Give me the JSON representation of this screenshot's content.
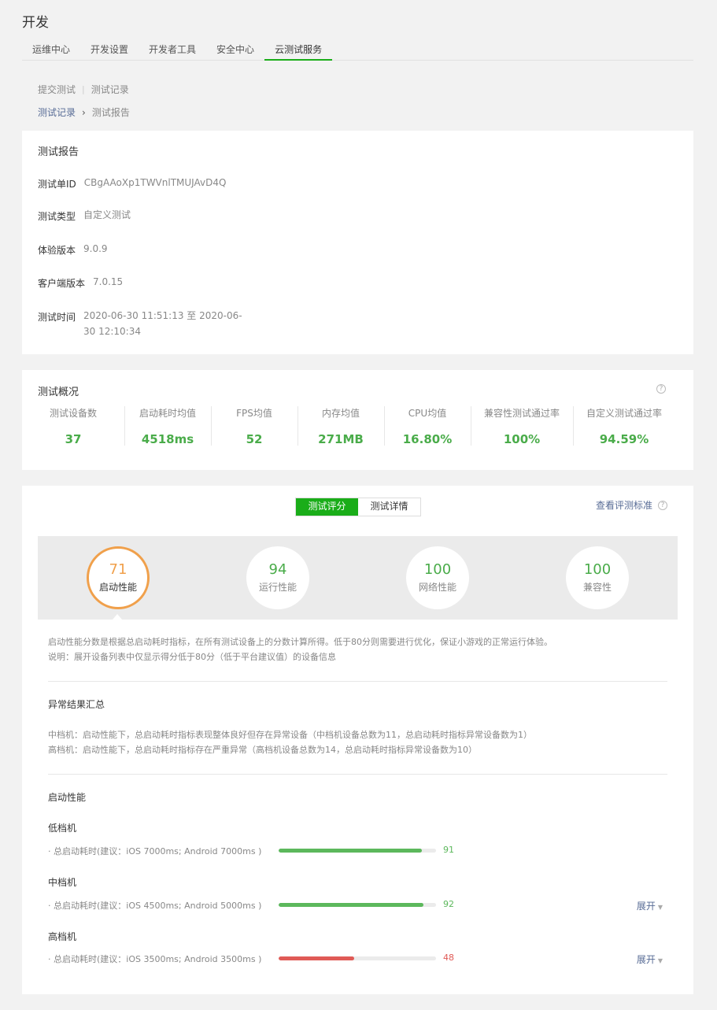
{
  "page_title": "开发",
  "top_tabs": [
    {
      "label": "运维中心"
    },
    {
      "label": "开发设置"
    },
    {
      "label": "开发者工具"
    },
    {
      "label": "安全中心"
    },
    {
      "label": "云测试服务",
      "active": true
    }
  ],
  "sub_nav": {
    "submit": "提交测试",
    "records": "测试记录"
  },
  "breadcrumb": {
    "parent": "测试记录",
    "current": "测试报告"
  },
  "report": {
    "title": "测试报告",
    "fields": [
      {
        "label": "测试单ID",
        "value": "CBgAAoXp1TWVnlTMUJAvD4Q"
      },
      {
        "label": "测试类型",
        "value": "自定义测试"
      },
      {
        "label": "体验版本",
        "value": "9.0.9"
      },
      {
        "label": "客户端版本",
        "value": "7.0.15"
      },
      {
        "label": "测试时间",
        "value": "2020-06-30 11:51:13 至 2020-06-30 12:10:34"
      }
    ]
  },
  "overview": {
    "title": "测试概况",
    "help": "?",
    "stats": [
      {
        "label": "测试设备数",
        "value": "37"
      },
      {
        "label": "启动耗时均值",
        "value": "4518ms"
      },
      {
        "label": "FPS均值",
        "value": "52"
      },
      {
        "label": "内存均值",
        "value": "271MB"
      },
      {
        "label": "CPU均值",
        "value": "16.80%"
      },
      {
        "label": "兼容性测试通过率",
        "value": "100%"
      },
      {
        "label": "自定义测试通过率",
        "value": "94.59%"
      }
    ]
  },
  "score": {
    "tabs": {
      "score": "测试评分",
      "detail": "测试详情"
    },
    "criteria_link": "查看评测标准",
    "help": "?",
    "circles": [
      {
        "score": "71",
        "label": "启动性能",
        "selected": true
      },
      {
        "score": "94",
        "label": "运行性能"
      },
      {
        "score": "100",
        "label": "网络性能"
      },
      {
        "score": "100",
        "label": "兼容性"
      }
    ],
    "desc_lines": [
      "启动性能分数是根据总启动耗时指标，在所有测试设备上的分数计算所得。低于80分则需要进行优化，保证小游戏的正常运行体验。",
      "说明：展开设备列表中仅显示得分低于80分（低于平台建议值）的设备信息"
    ],
    "anomaly_title": "异常结果汇总",
    "anomaly_lines": [
      "中档机：启动性能下，总启动耗时指标表现整体良好但存在异常设备（中档机设备总数为11，总启动耗时指标异常设备数为1）",
      "高档机：启动性能下，总启动耗时指标存在严重异常（高档机设备总数为14，总启动耗时指标异常设备数为10）"
    ],
    "perf_title": "启动性能",
    "expand_label": "展开",
    "colors": {
      "good": "#5cb85c",
      "bad": "#e05a56"
    },
    "tiers": [
      {
        "name": "低档机",
        "metric": "· 总启动耗时(建议：iOS 7000ms; Android 7000ms )",
        "value": 91,
        "value_text": "91",
        "status": "good",
        "expandable": false
      },
      {
        "name": "中档机",
        "metric": "· 总启动耗时(建议：iOS 4500ms; Android 5000ms )",
        "value": 92,
        "value_text": "92",
        "status": "good",
        "expandable": true
      },
      {
        "name": "高档机",
        "metric": "· 总启动耗时(建议：iOS 3500ms; Android 3500ms )",
        "value": 48,
        "value_text": "48",
        "status": "bad",
        "expandable": true
      }
    ]
  }
}
